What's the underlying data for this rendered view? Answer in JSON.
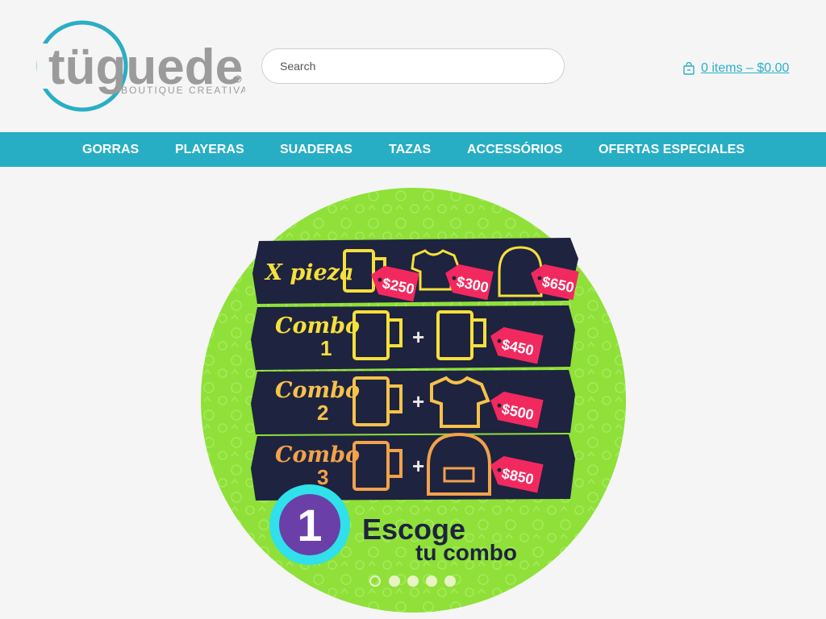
{
  "brand": {
    "logo_text": "tügueder",
    "tagline": "BOUTIQUE CREATIVA",
    "colors": {
      "teal": "#27aec4",
      "gray": "#9b9b9b"
    }
  },
  "search": {
    "placeholder": "Search",
    "value": ""
  },
  "cart": {
    "label": "0 items – $0.00",
    "icon": "shopping-bag-icon"
  },
  "nav": {
    "items": [
      {
        "label": "GORRAS"
      },
      {
        "label": "PLAYERAS"
      },
      {
        "label": "SUADERAS"
      },
      {
        "label": "TAZAS"
      },
      {
        "label": "ACCESSÓRIOS"
      },
      {
        "label": "OFERTAS ESPECIALES"
      }
    ]
  },
  "hero": {
    "rows": [
      {
        "label": "X pieza",
        "prices": [
          "$250",
          "$300",
          "$650"
        ]
      },
      {
        "label": "Combo",
        "number": "1",
        "price": "$450"
      },
      {
        "label": "Combo",
        "number": "2",
        "price": "$500"
      },
      {
        "label": "Combo",
        "number": "3",
        "price": "$850"
      }
    ],
    "step_number": "1",
    "headline": "Escoge",
    "subheadline": "tu combo",
    "colors": {
      "green": "#8fe038",
      "navy": "#1e2340",
      "yellow": "#f6e03a",
      "orange": "#f2a24a",
      "pink": "#f2295f",
      "purple": "#6a3fa8",
      "cyan": "#30e0ea"
    }
  },
  "slider": {
    "count": 5,
    "active_index": 0
  }
}
